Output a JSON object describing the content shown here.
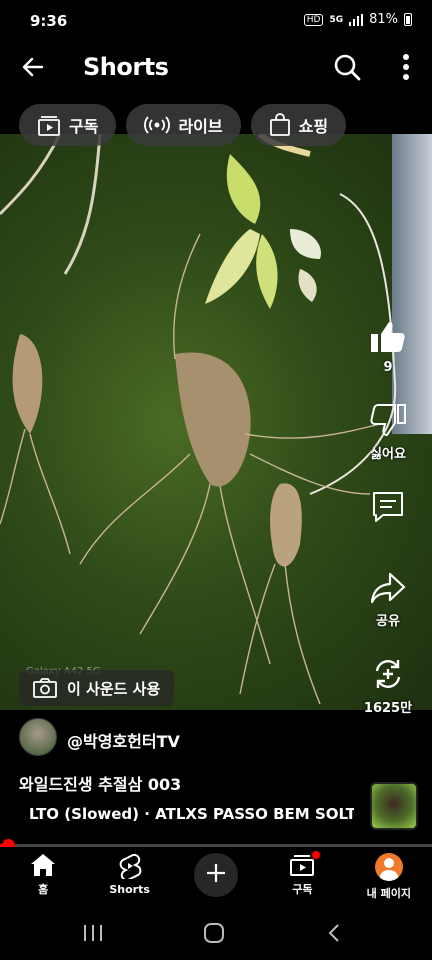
{
  "status": {
    "time": "9:36",
    "network": "5G",
    "hd": "HD",
    "battery": "81%"
  },
  "header": {
    "title": "Shorts"
  },
  "filters": [
    {
      "label": "구독",
      "icon": "subscriptions-icon"
    },
    {
      "label": "라이브",
      "icon": "live-icon"
    },
    {
      "label": "쇼핑",
      "icon": "shopping-bag-icon"
    }
  ],
  "video": {
    "watermark": "Galaxy A42 5G",
    "sound_chip": "이 사운드 사용"
  },
  "actions": {
    "likes": "9",
    "dislike": "싫어요",
    "share": "공유",
    "remix": "1625만"
  },
  "info": {
    "channel": "@박영호헌터TV",
    "title": "와일드진생 추절삼 003",
    "music": "LTO (Slowed) · ATLXS    PASSO BEM SOLTO"
  },
  "progress": 0.02,
  "nav": {
    "home": "홈",
    "shorts": "Shorts",
    "subscriptions": "구독",
    "profile": "내 페이지"
  }
}
